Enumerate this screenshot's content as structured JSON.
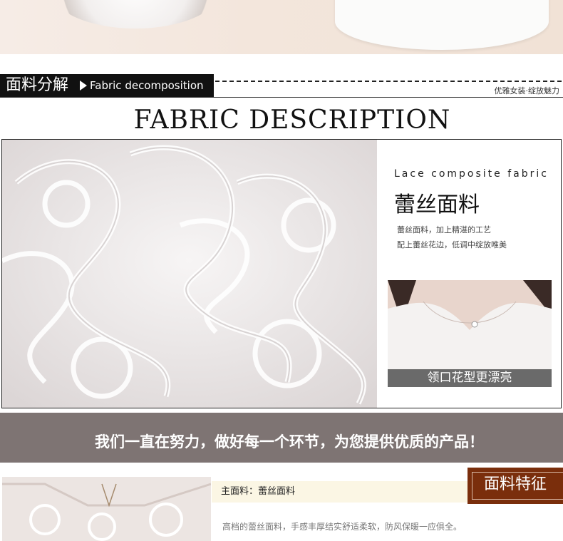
{
  "header": {
    "section_title_zh": "面料分解",
    "section_title_en": "Fabric decomposition",
    "tagline": "优雅女装·绽放魅力"
  },
  "fabric": {
    "title": "FABRIC DESCRIPTION",
    "lace_en": "Lace composite fabric",
    "lace_zh": "蕾丝面料",
    "desc_line1": "蕾丝面料，加上精湛的工艺",
    "desc_line2": "配上蕾丝花边，低调中绽放唯美",
    "neck_caption": "领口花型更漂亮"
  },
  "banner": {
    "text": "我们一直在努力，做好每一个环节，为您提供优质的产品！"
  },
  "features": {
    "tab_label": "面料特征",
    "material_label": "主面料：蕾丝面料",
    "material_desc": "高档的蕾丝面料，手感丰厚结实舒适柔软，防风保暖一应俱全。"
  },
  "colors": {
    "banner_bg": "#7e7473",
    "feature_tab_bg": "#7a2e0c",
    "material_bar_bg": "#fbf6e4"
  }
}
